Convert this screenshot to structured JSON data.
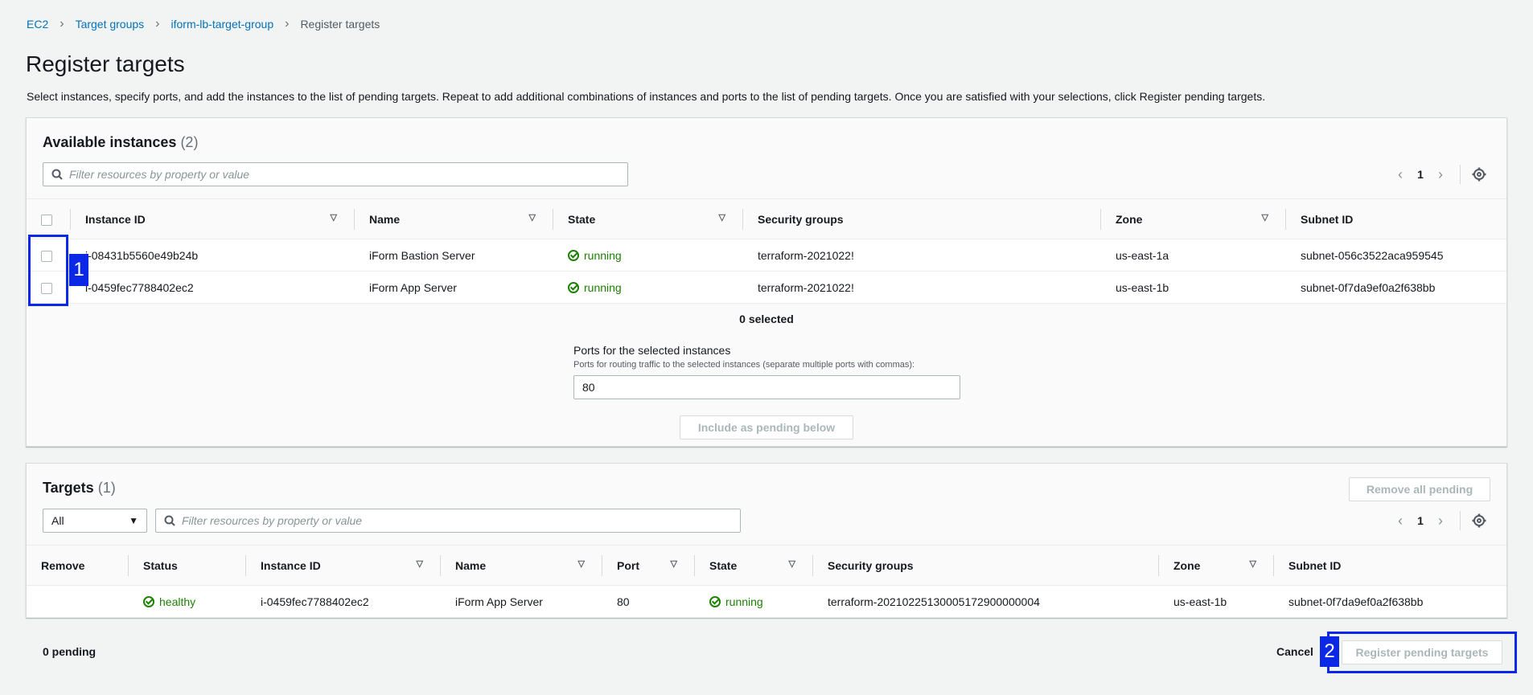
{
  "breadcrumb": {
    "items": [
      "EC2",
      "Target groups",
      "iform-lb-target-group"
    ],
    "current": "Register targets"
  },
  "page": {
    "title": "Register targets",
    "description": "Select instances, specify ports, and add the instances to the list of pending targets. Repeat to add additional combinations of instances and ports to the list of pending targets. Once you are satisfied with your selections, click Register pending targets."
  },
  "available": {
    "title": "Available instances",
    "count": "(2)",
    "search_placeholder": "Filter resources by property or value",
    "page": "1",
    "columns": [
      "Instance ID",
      "Name",
      "State",
      "Security groups",
      "Zone",
      "Subnet ID"
    ],
    "rows": [
      {
        "instance_id": "i-08431b5560e49b24b",
        "name": "iForm Bastion Server",
        "state": "running",
        "security_groups": "terraform-2021022!",
        "zone": "us-east-1a",
        "subnet": "subnet-056c3522aca959545"
      },
      {
        "instance_id": "i-0459fec7788402ec2",
        "name": "iForm App Server",
        "state": "running",
        "security_groups": "terraform-2021022!",
        "zone": "us-east-1b",
        "subnet": "subnet-0f7da9ef0a2f638bb"
      }
    ],
    "selected_text": "0 selected",
    "ports_label": "Ports for the selected instances",
    "ports_help": "Ports for routing traffic to the selected instances (separate multiple ports with commas):",
    "ports_value": "80",
    "include_button": "Include as pending below"
  },
  "targets": {
    "title": "Targets",
    "count": "(1)",
    "remove_all_button": "Remove all pending",
    "filter_value": "All",
    "search_placeholder": "Filter resources by property or value",
    "page": "1",
    "columns": [
      "Remove",
      "Status",
      "Instance ID",
      "Name",
      "Port",
      "State",
      "Security groups",
      "Zone",
      "Subnet ID"
    ],
    "rows": [
      {
        "status": "healthy",
        "instance_id": "i-0459fec7788402ec2",
        "name": "iForm App Server",
        "port": "80",
        "state": "running",
        "security_groups": "terraform-20210225130005172900000004",
        "zone": "us-east-1b",
        "subnet": "subnet-0f7da9ef0a2f638bb"
      }
    ]
  },
  "footer": {
    "pending_text": "0 pending",
    "cancel_label": "Cancel",
    "register_label": "Register pending targets"
  },
  "annotations": [
    "1",
    "2"
  ],
  "colors": {
    "accent": "#0073bb",
    "success": "#1d8102",
    "annotation": "#0a28e6"
  }
}
